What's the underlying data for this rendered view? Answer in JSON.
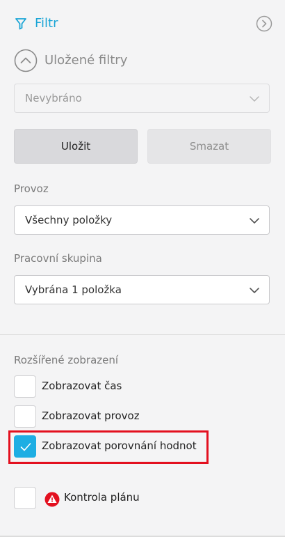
{
  "header": {
    "title": "Filtr",
    "icon": "funnel-icon",
    "collapse_icon": "chevron-right-circle-icon"
  },
  "saved_filters": {
    "label": "Uložené filtry",
    "select_value": "Nevybráno",
    "save_label": "Uložit",
    "delete_label": "Smazat"
  },
  "provoz": {
    "label": "Provoz",
    "value": "Všechny položky"
  },
  "pracovni_skupina": {
    "label": "Pracovní skupina",
    "value": "Vybrána 1 položka"
  },
  "extended": {
    "label": "Rozšířené zobrazení",
    "options": [
      {
        "label": "Zobrazovat čas",
        "checked": false
      },
      {
        "label": "Zobrazovat provoz",
        "checked": false
      },
      {
        "label": "Zobrazovat porovnání hodnot",
        "checked": true
      }
    ],
    "plan_check": {
      "label": "Kontrola plánu",
      "checked": false,
      "icon": "warning-icon"
    }
  },
  "colors": {
    "accent": "#1aa5d6",
    "checkbox_checked": "#1eaee3",
    "highlight": "#e3101f",
    "warning": "#e3101f"
  }
}
